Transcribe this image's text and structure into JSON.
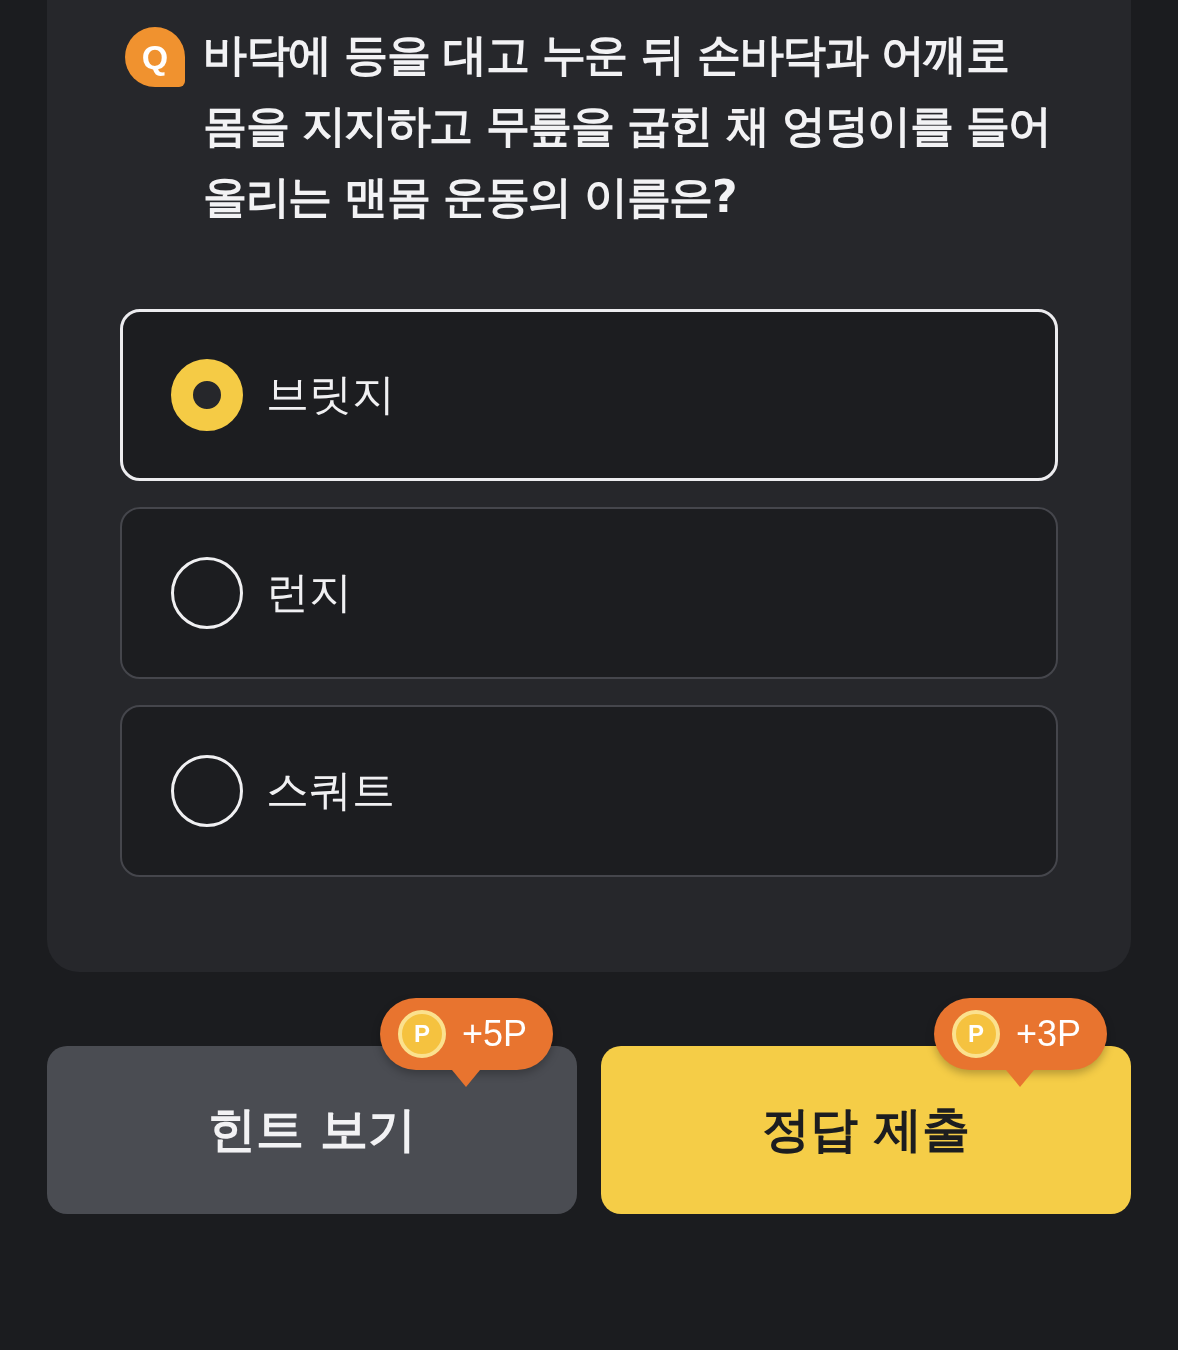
{
  "question": {
    "badge": "Q",
    "text": "바닥에 등을 대고 누운 뒤 손바닥과 어깨로 몸을 지지하고 무릎을 굽힌 채 엉덩이를 들어 올리는 맨몸 운동의 이름은?"
  },
  "options": [
    {
      "label": "브릿지",
      "selected": true
    },
    {
      "label": "런지",
      "selected": false
    },
    {
      "label": "스쿼트",
      "selected": false
    }
  ],
  "actions": [
    {
      "kind": "hint",
      "label": "힌트 보기",
      "reward": {
        "coin": "P",
        "amount": "+5P"
      }
    },
    {
      "kind": "submit",
      "label": "정답 제출",
      "reward": {
        "coin": "P",
        "amount": "+3P"
      }
    }
  ]
}
